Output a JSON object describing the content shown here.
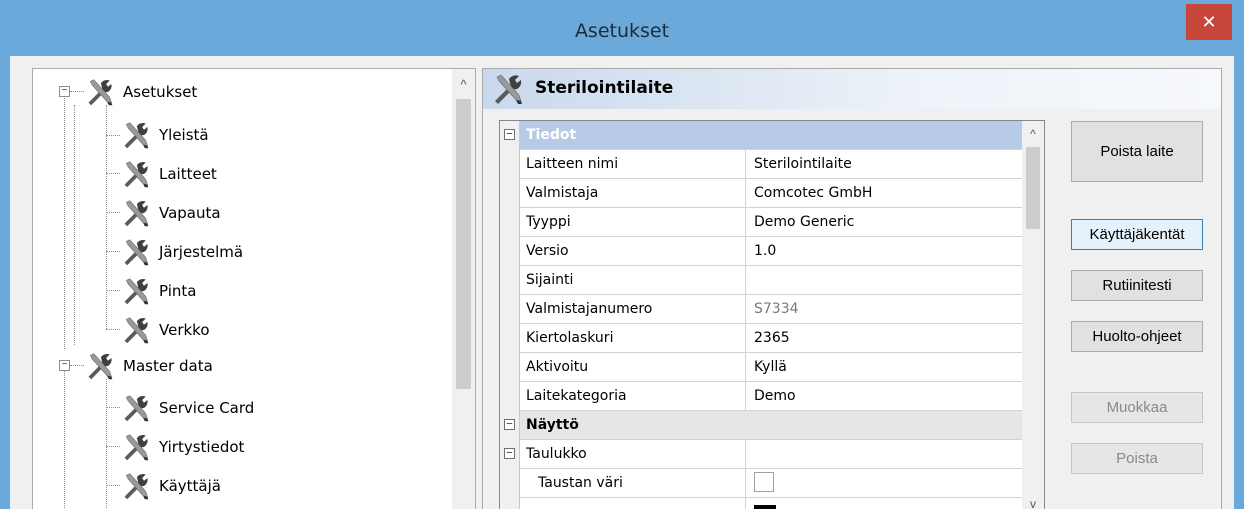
{
  "window": {
    "title": "Asetukset",
    "close_glyph": "✕"
  },
  "tree": {
    "items": [
      {
        "label": "Asetukset",
        "level": 0
      },
      {
        "label": "Yleistä",
        "level": 1
      },
      {
        "label": "Laitteet",
        "level": 1
      },
      {
        "label": "Vapauta",
        "level": 1
      },
      {
        "label": "Järjestelmä",
        "level": 1
      },
      {
        "label": "Pinta",
        "level": 1
      },
      {
        "label": "Verkko",
        "level": 1
      },
      {
        "label": "Master data",
        "level": 0
      },
      {
        "label": "Service Card",
        "level": 1
      },
      {
        "label": "Yirtystiedot",
        "level": 1
      },
      {
        "label": "Käyttäjä",
        "level": 1
      }
    ],
    "expander_glyph": "−",
    "scroll_up_glyph": "^"
  },
  "panel": {
    "title": "Sterilointilaite"
  },
  "grid": {
    "sections": {
      "tiedot": "Tiedot",
      "naytto": "Näyttö",
      "taulukko": "Taulukko"
    },
    "rows": [
      {
        "name": "Laitteen nimi",
        "value": "Sterilointilaite"
      },
      {
        "name": "Valmistaja",
        "value": "Comcotec GmbH"
      },
      {
        "name": "Tyyppi",
        "value": "Demo Generic"
      },
      {
        "name": "Versio",
        "value": "1.0"
      },
      {
        "name": "Sijainti",
        "value": ""
      },
      {
        "name": "Valmistajanumero",
        "value": "S7334"
      },
      {
        "name": "Kiertolaskuri",
        "value": "2365"
      },
      {
        "name": "Aktivoitu",
        "value": "Kyllä"
      },
      {
        "name": "Laitekategoria",
        "value": "Demo"
      }
    ],
    "taustan_vari": "Taustan väri",
    "scroll_up_glyph": "^",
    "scroll_down_glyph": "v"
  },
  "buttons": {
    "poista_laite": "Poista laite",
    "kayttajakentat": "Käyttäjäkentät",
    "rutiinitesti": "Rutiinitesti",
    "huolto_ohjeet": "Huolto-ohjeet",
    "muokkaa": "Muokkaa",
    "poista": "Poista"
  },
  "colors": {
    "titlebar": "#6aa9d9",
    "close": "#c7463a",
    "selected_section": "#b7cbe6"
  }
}
